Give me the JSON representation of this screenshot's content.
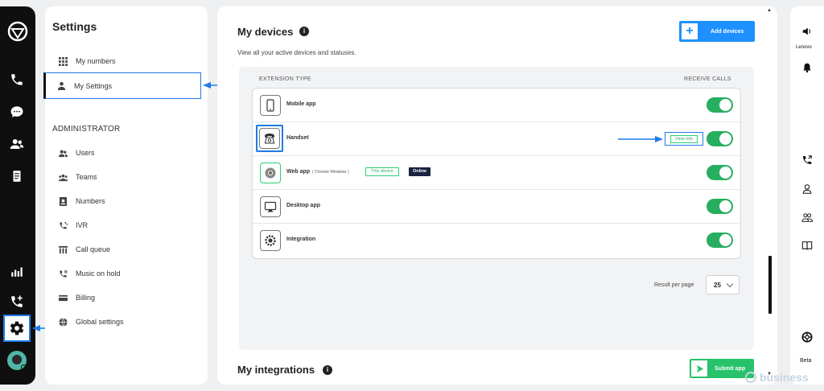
{
  "settings": {
    "title": "Settings",
    "items": [
      {
        "label": "My numbers",
        "icon": "grid-icon"
      },
      {
        "label": "My Settings",
        "icon": "user-icon"
      }
    ],
    "admin_label": "ADMINISTRATOR",
    "admin_items": [
      {
        "label": "Users",
        "icon": "users-icon"
      },
      {
        "label": "Teams",
        "icon": "teams-icon"
      },
      {
        "label": "Numbers",
        "icon": "numbers-icon"
      },
      {
        "label": "IVR",
        "icon": "ivr-icon"
      },
      {
        "label": "Call queue",
        "icon": "call-queue-icon"
      },
      {
        "label": "Music on hold",
        "icon": "music-on-hold-icon"
      },
      {
        "label": "Billing",
        "icon": "billing-icon"
      },
      {
        "label": "Global settings",
        "icon": "globe-icon"
      }
    ]
  },
  "main": {
    "title": "My devices",
    "subtitle": "View all your active devices and statuses.",
    "add_button": "Add devices",
    "col_type": "EXTENSION TYPE",
    "col_receive": "RECEIVE CALLS",
    "devices": [
      {
        "name": "Mobile app",
        "sub": "",
        "receive_calls": true
      },
      {
        "name": "Handset",
        "sub": "",
        "receive_calls": true,
        "action": "View info"
      },
      {
        "name": "Web app",
        "sub": "( Chrome Windows )",
        "tag": "This device",
        "status": "Online",
        "receive_calls": true
      },
      {
        "name": "Desktop app",
        "sub": "",
        "receive_calls": true
      },
      {
        "name": "Integration",
        "sub": "",
        "receive_calls": true
      }
    ],
    "results_label": "Result per page",
    "results_value": "25",
    "integrations_title": "My integrations",
    "submit_button": "Submit app"
  },
  "right_panel": {
    "lenovo": "Lenovo",
    "beta": "Beta"
  },
  "watermark": "business",
  "colors": {
    "accent_blue": "#1e90ff",
    "green": "#27ae60",
    "annotation_blue": "#1e7be6"
  }
}
